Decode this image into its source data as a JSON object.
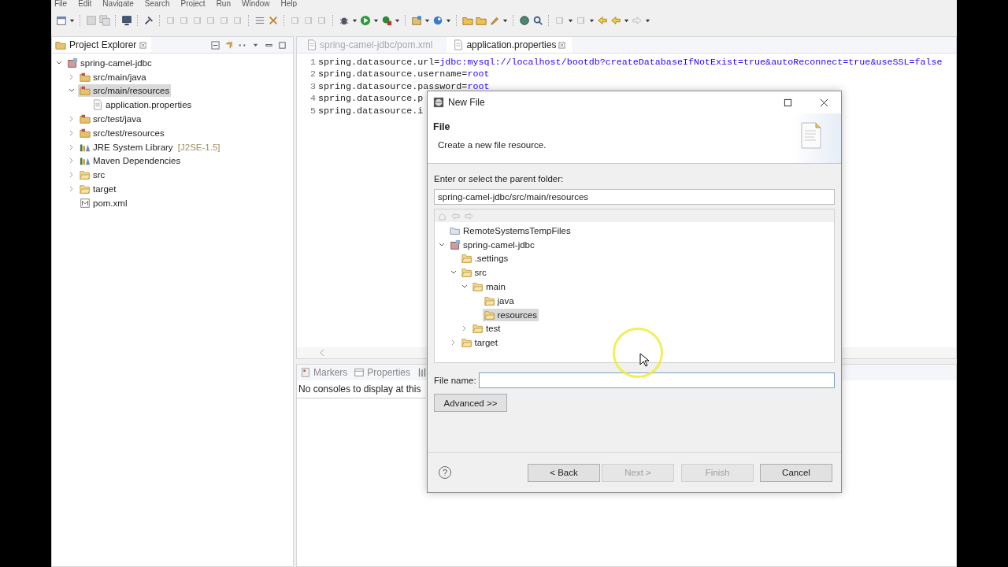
{
  "window": {
    "menu": [
      "File",
      "Edit",
      "Navigate",
      "Search",
      "Project",
      "Run",
      "Window",
      "Help"
    ]
  },
  "project_explorer": {
    "title": "Project Explorer",
    "tree": [
      {
        "label": "spring-camel-jdbc",
        "kind": "project",
        "expanded": true,
        "selected": false,
        "children": [
          {
            "label": "src/main/java",
            "kind": "source-folder",
            "expanded": false,
            "selected": false
          },
          {
            "label": "src/main/resources",
            "kind": "source-folder",
            "expanded": true,
            "selected": true,
            "children": [
              {
                "label": "application.properties",
                "kind": "file",
                "selected": false
              }
            ]
          },
          {
            "label": "src/test/java",
            "kind": "source-folder",
            "expanded": false,
            "selected": false
          },
          {
            "label": "src/test/resources",
            "kind": "source-folder",
            "expanded": false,
            "selected": false
          },
          {
            "label": "JRE System Library",
            "decoration": "[J2SE-1.5]",
            "kind": "library",
            "expanded": false,
            "selected": false
          },
          {
            "label": "Maven Dependencies",
            "kind": "library",
            "expanded": false,
            "selected": false
          },
          {
            "label": "src",
            "kind": "folder",
            "expanded": false,
            "selected": false
          },
          {
            "label": "target",
            "kind": "folder",
            "expanded": false,
            "selected": false
          },
          {
            "label": "pom.xml",
            "kind": "xml",
            "selected": false
          }
        ]
      }
    ]
  },
  "editor": {
    "tabs": [
      {
        "label": "spring-camel-jdbc/pom.xml",
        "selected": false
      },
      {
        "label": "application.properties",
        "selected": true
      }
    ],
    "lines": [
      {
        "number": "1",
        "key": "spring.datasource.url=",
        "value": "jdbc:mysql://localhost/bootdb?createDatabaseIfNotExist=true&autoReconnect=true&useSSL=false"
      },
      {
        "number": "2",
        "key": "spring.datasource.username=",
        "value": "root"
      },
      {
        "number": "3",
        "key": "spring.datasource.password=",
        "value": "root"
      },
      {
        "number": "4",
        "key": "spring.datasource.p"
      },
      {
        "number": "5",
        "key": "spring.datasource.i"
      }
    ]
  },
  "bottom_panel": {
    "tabs": [
      {
        "label": "Markers",
        "kind": "markers"
      },
      {
        "label": "Properties",
        "kind": "properties"
      },
      {
        "kind": "servers"
      }
    ],
    "message": "No consoles to display at this"
  },
  "dialog": {
    "title": "New File",
    "heading": "File",
    "description": "Create a new file resource.",
    "folder_label": "Enter or select the parent folder:",
    "folder_value": "spring-camel-jdbc/src/main/resources",
    "tree": [
      {
        "label": "RemoteSystemsTempFiles",
        "kind": "open-folder",
        "selected": false
      },
      {
        "label": "spring-camel-jdbc",
        "kind": "project",
        "expanded": true,
        "selected": false,
        "children": [
          {
            "label": ".settings",
            "kind": "folder",
            "selected": false
          },
          {
            "label": "src",
            "kind": "folder",
            "expanded": true,
            "selected": false,
            "children": [
              {
                "label": "main",
                "kind": "folder",
                "expanded": true,
                "selected": false,
                "children": [
                  {
                    "label": "java",
                    "kind": "folder",
                    "selected": false
                  },
                  {
                    "label": "resources",
                    "kind": "folder",
                    "selected": true
                  }
                ]
              },
              {
                "label": "test",
                "kind": "folder",
                "expanded": false,
                "selected": false
              }
            ]
          },
          {
            "label": "target",
            "kind": "folder",
            "expanded": false,
            "selected": false
          }
        ]
      }
    ],
    "file_name_label": "File name:",
    "advanced_button": "Advanced >>",
    "help": "?",
    "buttons": [
      {
        "label": "< Back",
        "disabled": false
      },
      {
        "label": "Next >",
        "disabled": true
      },
      {
        "label": "Finish",
        "disabled": true
      },
      {
        "label": "Cancel",
        "disabled": false
      }
    ]
  }
}
